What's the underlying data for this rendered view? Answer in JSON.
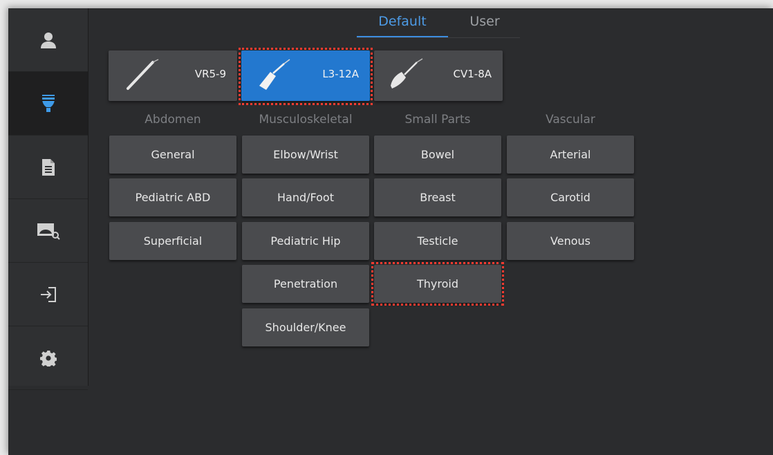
{
  "tabs": {
    "default_label": "Default",
    "user_label": "User"
  },
  "sidebar": {
    "icons": [
      "user-icon",
      "probe-icon",
      "document-icon",
      "image-review-icon",
      "login-icon",
      "gear-icon"
    ]
  },
  "probes": [
    {
      "label": "VR5-9",
      "selected": false
    },
    {
      "label": "L3-12A",
      "selected": true
    },
    {
      "label": "CV1-8A",
      "selected": false
    }
  ],
  "categories": [
    "Abdomen",
    "Musculoskeletal",
    "Small Parts",
    "Vascular"
  ],
  "presets": {
    "abdomen": [
      "General",
      "Pediatric ABD",
      "Superficial"
    ],
    "musculoskeletal": [
      "Elbow/Wrist",
      "Hand/Foot",
      "Pediatric Hip",
      "Penetration",
      "Shoulder/Knee"
    ],
    "small_parts": [
      "Bowel",
      "Breast",
      "Testicle",
      "Thyroid"
    ],
    "vascular": [
      "Arterial",
      "Carotid",
      "Venous"
    ]
  },
  "colors": {
    "accent": "#2378cf",
    "highlight": "#ff3b30",
    "background": "#2b2c2e"
  }
}
